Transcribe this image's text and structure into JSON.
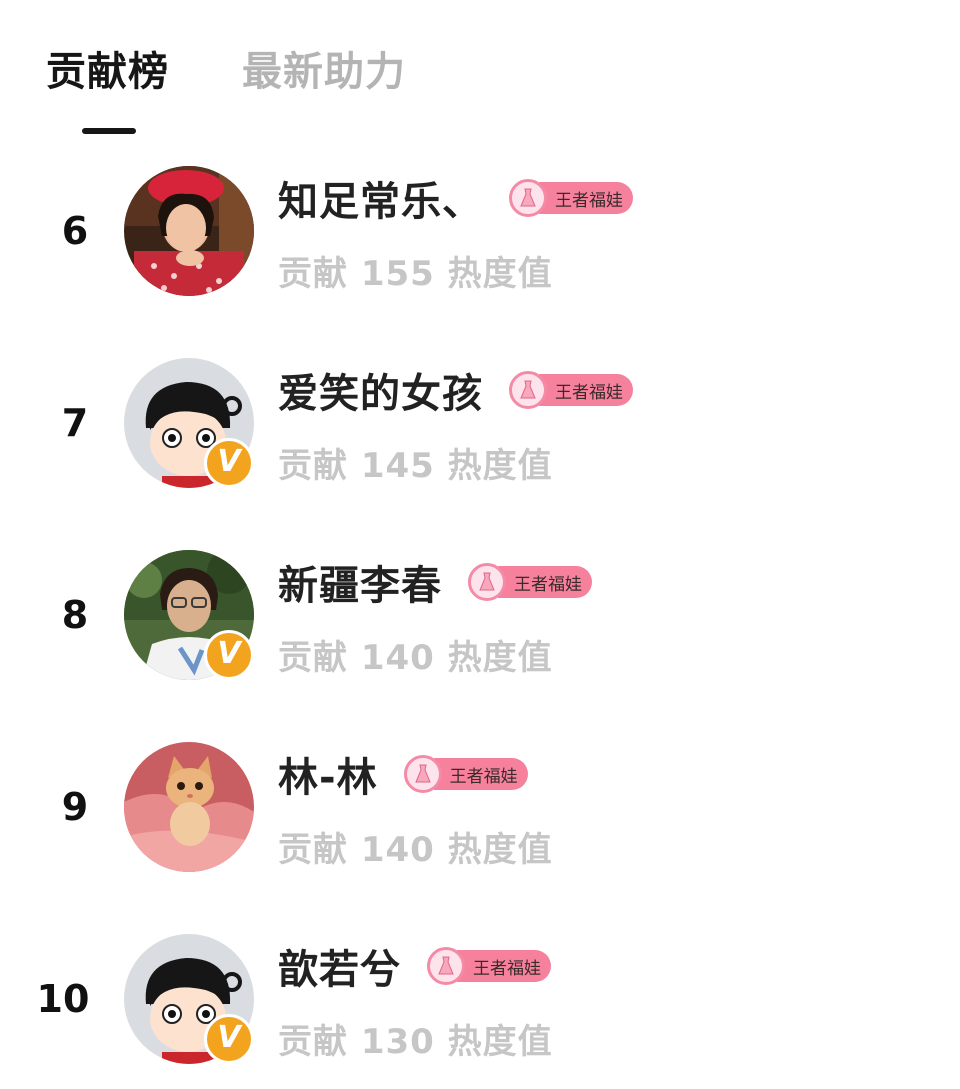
{
  "tabs": [
    {
      "label": "贡献榜",
      "active": true
    },
    {
      "label": "最新助力",
      "active": false
    }
  ],
  "rows": [
    {
      "rank": "6",
      "name": "知足常乐、",
      "badge": "王者福娃",
      "contribution": "贡献 155 热度值",
      "verified": false,
      "avatar": "avatar-photo-woman-red-hat"
    },
    {
      "rank": "7",
      "name": "爱笑的女孩",
      "badge": "王者福娃",
      "contribution": "贡献 145 热度值",
      "verified": true,
      "avatar": "avatar-default-cartoon"
    },
    {
      "rank": "8",
      "name": "新疆李春",
      "badge": "王者福娃",
      "contribution": "贡献 140 热度值",
      "verified": true,
      "avatar": "avatar-photo-woman-glasses"
    },
    {
      "rank": "9",
      "name": "林-林",
      "badge": "王者福娃",
      "contribution": "贡献 140 热度值",
      "verified": false,
      "avatar": "avatar-photo-kitten"
    },
    {
      "rank": "10",
      "name": "歆若兮",
      "badge": "王者福娃",
      "contribution": "贡献 130 热度值",
      "verified": true,
      "avatar": "avatar-default-cartoon"
    }
  ],
  "verified_badge_glyph": "V",
  "colors": {
    "tab_active": "#161616",
    "tab_inactive": "#b4b4b4",
    "contribution_text": "#c6c6c6",
    "badge_pink": "#f6819d",
    "verified_orange": "#f3a41f"
  }
}
